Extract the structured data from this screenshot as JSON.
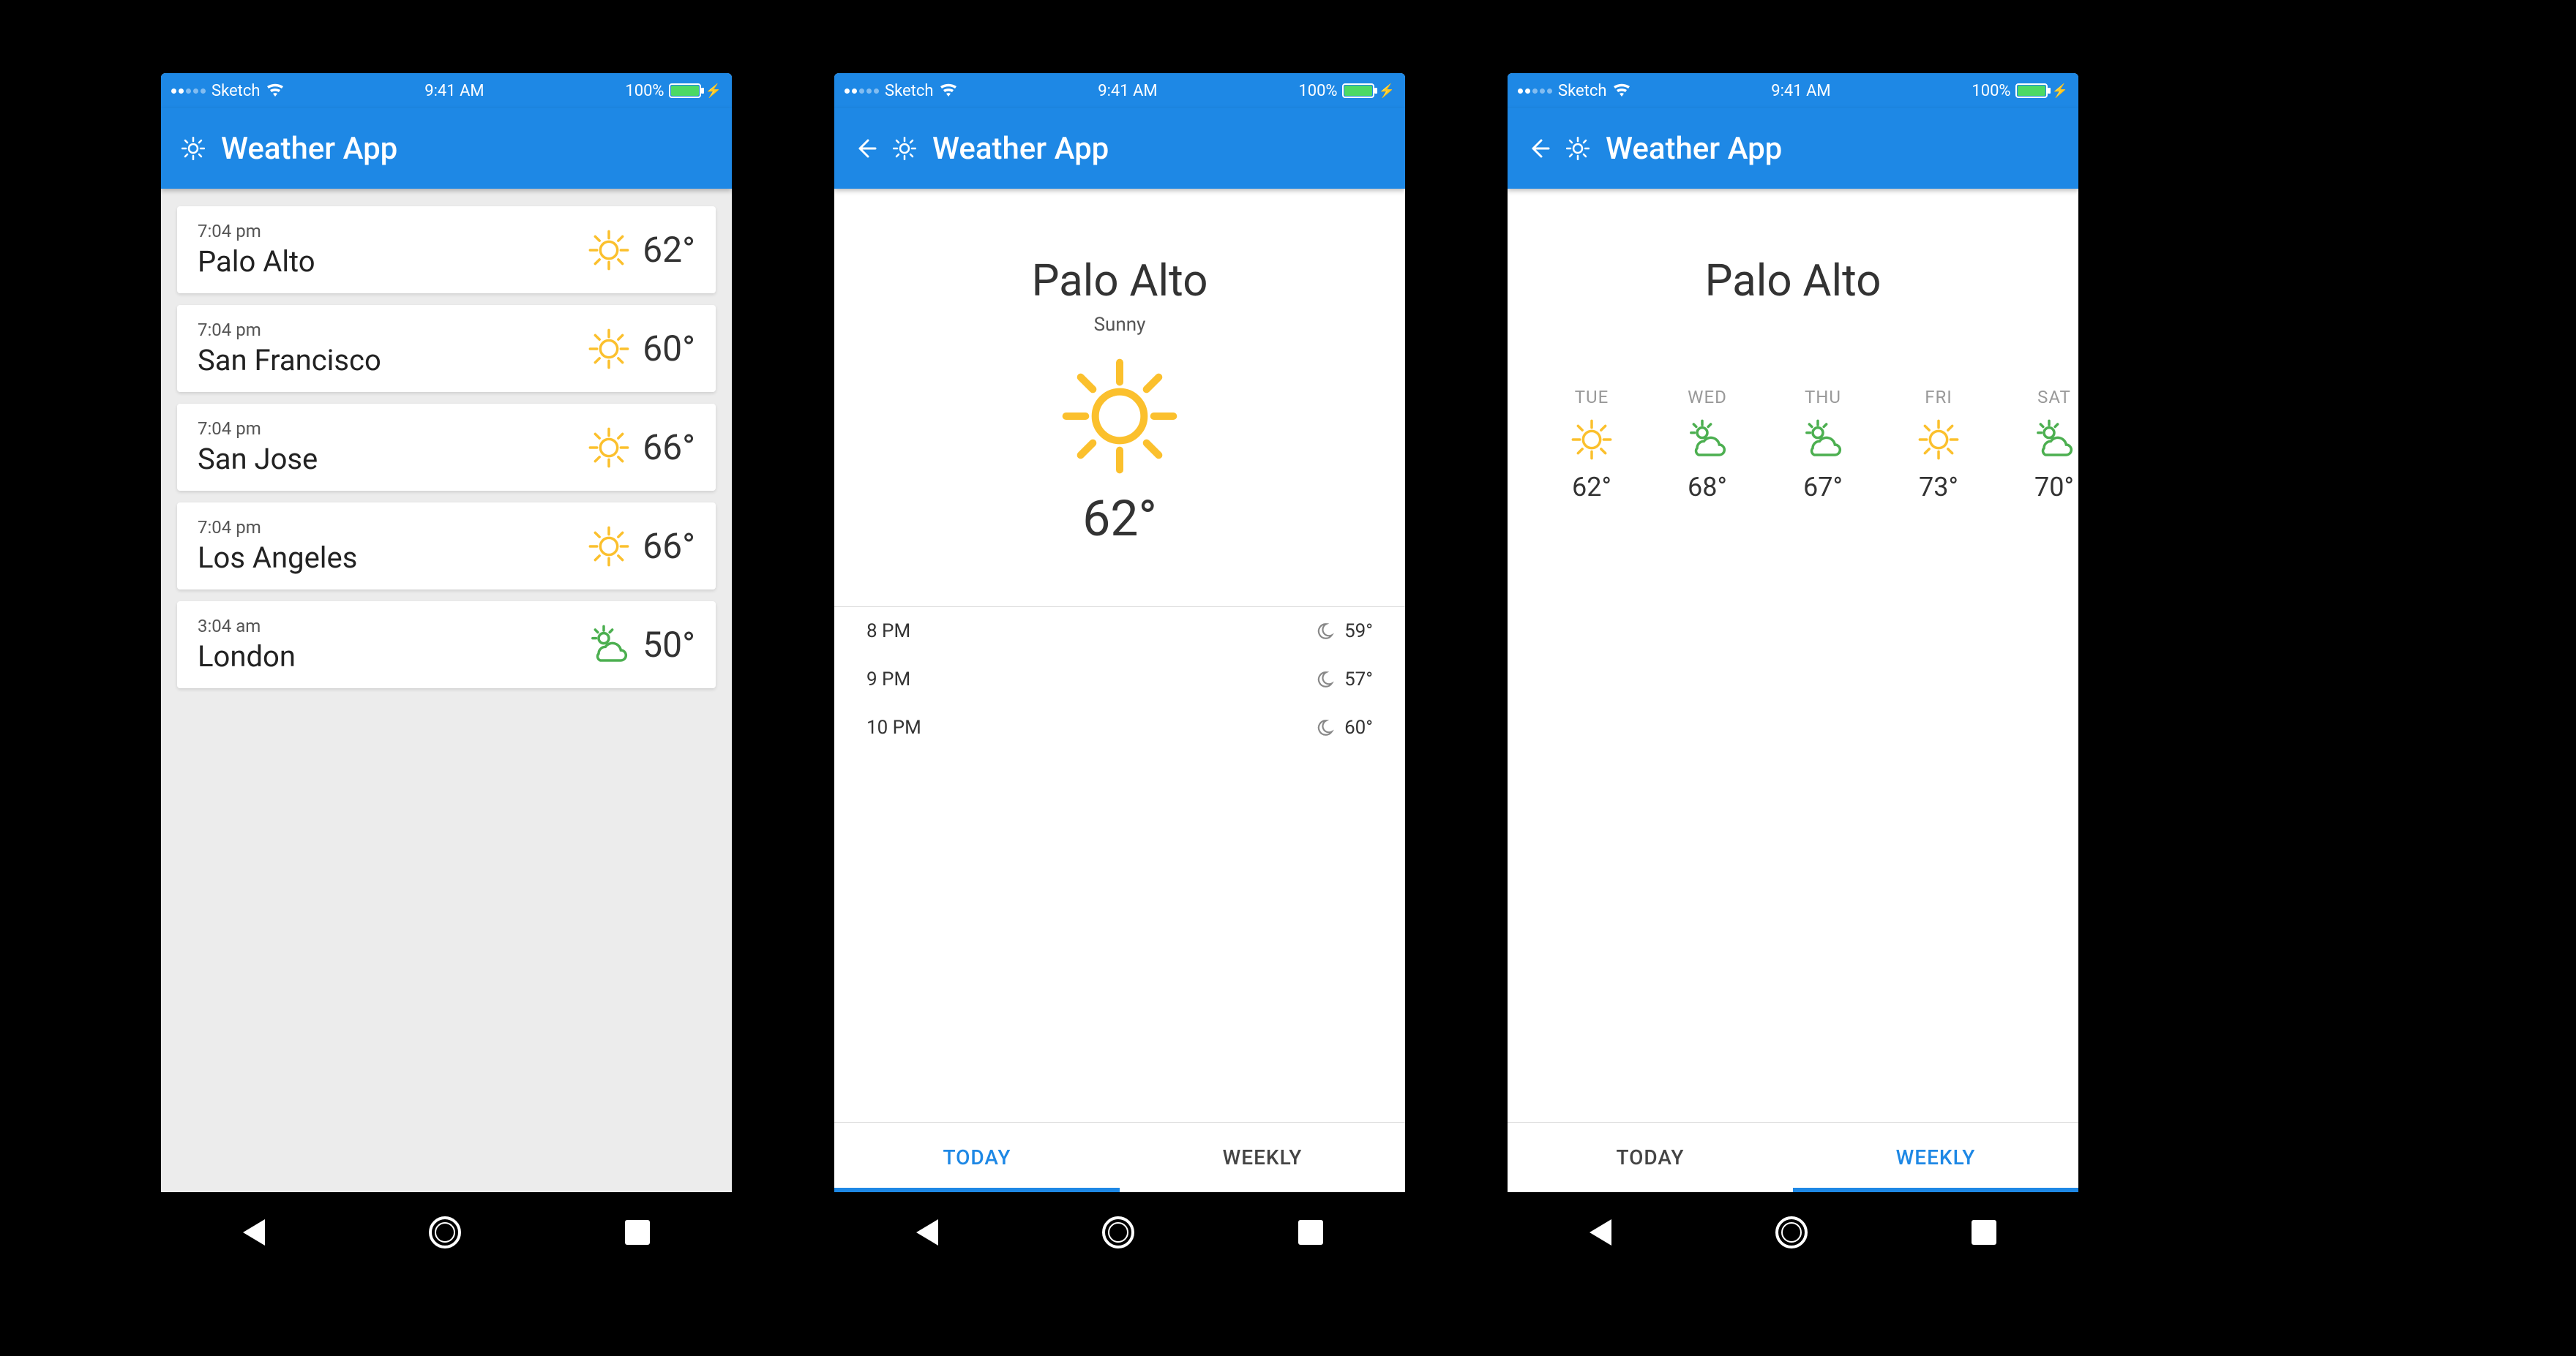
{
  "statusbar": {
    "carrier": "Sketch",
    "time": "9:41 AM",
    "battery": "100%"
  },
  "appbar": {
    "title": "Weather App"
  },
  "list": {
    "items": [
      {
        "time": "7:04 pm",
        "city": "Palo Alto",
        "temp": "62°",
        "icon": "sun"
      },
      {
        "time": "7:04 pm",
        "city": "San Francisco",
        "temp": "60°",
        "icon": "sun"
      },
      {
        "time": "7:04 pm",
        "city": "San Jose",
        "temp": "66°",
        "icon": "sun"
      },
      {
        "time": "7:04 pm",
        "city": "Los Angeles",
        "temp": "66°",
        "icon": "sun"
      },
      {
        "time": "3:04 am",
        "city": "London",
        "temp": "50°",
        "icon": "partly"
      }
    ]
  },
  "detail": {
    "city": "Palo Alto",
    "condition": "Sunny",
    "temp": "62°",
    "hourly": [
      {
        "time": "8 PM",
        "icon": "moon",
        "temp": "59°"
      },
      {
        "time": "9 PM",
        "icon": "moon",
        "temp": "57°"
      },
      {
        "time": "10 PM",
        "icon": "moon",
        "temp": "60°"
      }
    ],
    "tabs": {
      "today": "TODAY",
      "weekly": "WEEKLY"
    }
  },
  "weekly": {
    "city": "Palo Alto",
    "days": [
      {
        "name": "TUE",
        "icon": "sun",
        "temp": "62°"
      },
      {
        "name": "WED",
        "icon": "partly",
        "temp": "68°"
      },
      {
        "name": "THU",
        "icon": "partly",
        "temp": "67°"
      },
      {
        "name": "FRI",
        "icon": "sun",
        "temp": "73°"
      },
      {
        "name": "SAT",
        "icon": "partly",
        "temp": "70°"
      }
    ],
    "tabs": {
      "today": "TODAY",
      "weekly": "WEEKLY"
    }
  },
  "colors": {
    "primary": "#1e88e5",
    "sun": "#fbc02d",
    "cloud": "#4caf50"
  }
}
